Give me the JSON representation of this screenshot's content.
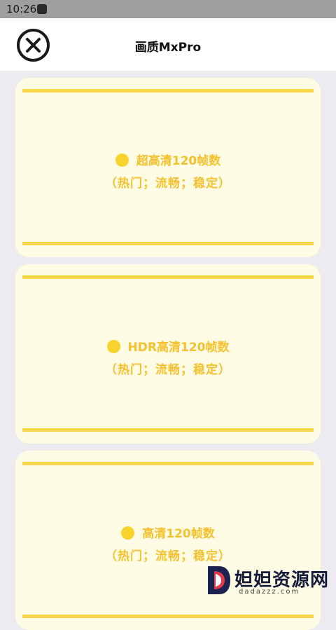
{
  "status_bar": {
    "time": "10:26"
  },
  "header": {
    "title": "画质MxPro",
    "close_icon": "close-circle-icon"
  },
  "options": [
    {
      "label": "超高清120帧数",
      "sub": "（热门；流畅；稳定）"
    },
    {
      "label": "HDR高清120帧数",
      "sub": "（热门；流畅；稳定）"
    },
    {
      "label": "高清120帧数",
      "sub": "（热门；流畅；稳定）"
    }
  ],
  "watermark": {
    "text": "妲妲资源网",
    "url": "dadazzz.com"
  },
  "colors": {
    "accent": "#f8d64a",
    "card_bg": "#fffce6",
    "text_accent": "#f4c02e"
  }
}
